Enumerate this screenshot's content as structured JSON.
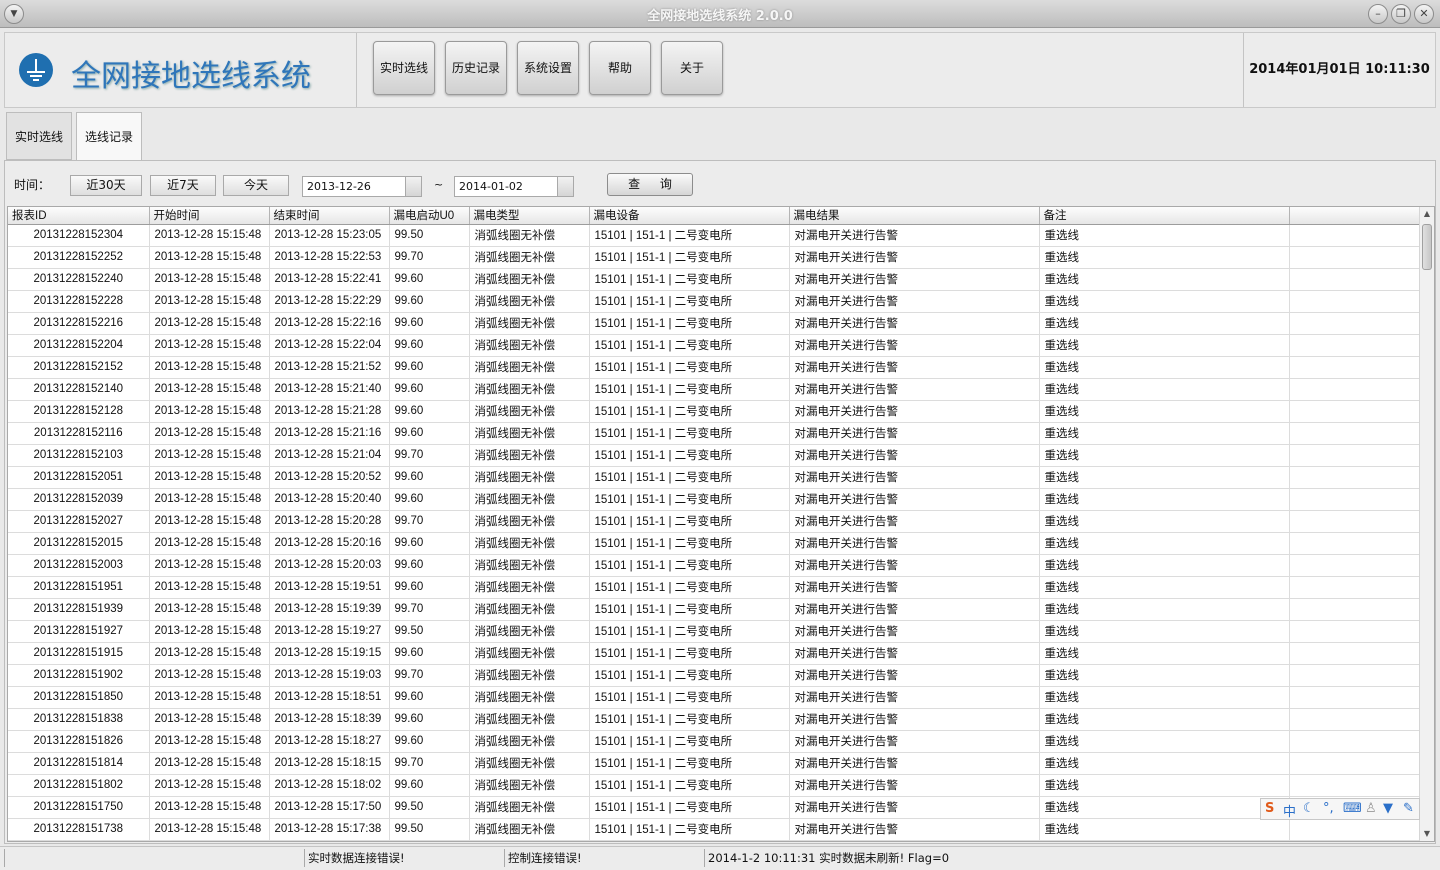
{
  "window": {
    "title": "全网接地选线系统 2.0.0",
    "menu_icon": "chevron-down-icon",
    "min_icon": "minimize-icon",
    "max_icon": "restore-icon",
    "close_icon": "close-icon"
  },
  "header": {
    "app_name": "全网接地选线系统",
    "logo_icon": "ground-symbol-icon",
    "nav_buttons": [
      "实时选线",
      "历史记录",
      "系统设置",
      "帮助",
      "关于"
    ],
    "datetime": "2014年01月01日 10:11:30"
  },
  "tabs": [
    "实时选线",
    "选线记录"
  ],
  "active_tab": "选线记录",
  "filter": {
    "label": "时间：",
    "quick_buttons": [
      "近30天",
      "近7天",
      "今天"
    ],
    "start_date": "2013-12-26",
    "separator": "~",
    "end_date": "2014-01-02",
    "query_label": "查 询"
  },
  "table": {
    "columns": [
      "报表ID",
      "开始时间",
      "结束时间",
      "漏电启动U0",
      "漏电类型",
      "漏电设备",
      "漏电结果",
      "备注"
    ],
    "rows": [
      [
        "20131228152304",
        "2013-12-28 15:15:48",
        "2013-12-28 15:23:05",
        "99.50",
        "消弧线圈无补偿",
        "15101 | 151-1 | 二号变电所",
        "对漏电开关进行告警",
        "重选线"
      ],
      [
        "20131228152252",
        "2013-12-28 15:15:48",
        "2013-12-28 15:22:53",
        "99.70",
        "消弧线圈无补偿",
        "15101 | 151-1 | 二号变电所",
        "对漏电开关进行告警",
        "重选线"
      ],
      [
        "20131228152240",
        "2013-12-28 15:15:48",
        "2013-12-28 15:22:41",
        "99.60",
        "消弧线圈无补偿",
        "15101 | 151-1 | 二号变电所",
        "对漏电开关进行告警",
        "重选线"
      ],
      [
        "20131228152228",
        "2013-12-28 15:15:48",
        "2013-12-28 15:22:29",
        "99.60",
        "消弧线圈无补偿",
        "15101 | 151-1 | 二号变电所",
        "对漏电开关进行告警",
        "重选线"
      ],
      [
        "20131228152216",
        "2013-12-28 15:15:48",
        "2013-12-28 15:22:16",
        "99.60",
        "消弧线圈无补偿",
        "15101 | 151-1 | 二号变电所",
        "对漏电开关进行告警",
        "重选线"
      ],
      [
        "20131228152204",
        "2013-12-28 15:15:48",
        "2013-12-28 15:22:04",
        "99.60",
        "消弧线圈无补偿",
        "15101 | 151-1 | 二号变电所",
        "对漏电开关进行告警",
        "重选线"
      ],
      [
        "20131228152152",
        "2013-12-28 15:15:48",
        "2013-12-28 15:21:52",
        "99.60",
        "消弧线圈无补偿",
        "15101 | 151-1 | 二号变电所",
        "对漏电开关进行告警",
        "重选线"
      ],
      [
        "20131228152140",
        "2013-12-28 15:15:48",
        "2013-12-28 15:21:40",
        "99.60",
        "消弧线圈无补偿",
        "15101 | 151-1 | 二号变电所",
        "对漏电开关进行告警",
        "重选线"
      ],
      [
        "20131228152128",
        "2013-12-28 15:15:48",
        "2013-12-28 15:21:28",
        "99.60",
        "消弧线圈无补偿",
        "15101 | 151-1 | 二号变电所",
        "对漏电开关进行告警",
        "重选线"
      ],
      [
        "20131228152116",
        "2013-12-28 15:15:48",
        "2013-12-28 15:21:16",
        "99.60",
        "消弧线圈无补偿",
        "15101 | 151-1 | 二号变电所",
        "对漏电开关进行告警",
        "重选线"
      ],
      [
        "20131228152103",
        "2013-12-28 15:15:48",
        "2013-12-28 15:21:04",
        "99.70",
        "消弧线圈无补偿",
        "15101 | 151-1 | 二号变电所",
        "对漏电开关进行告警",
        "重选线"
      ],
      [
        "20131228152051",
        "2013-12-28 15:15:48",
        "2013-12-28 15:20:52",
        "99.60",
        "消弧线圈无补偿",
        "15101 | 151-1 | 二号变电所",
        "对漏电开关进行告警",
        "重选线"
      ],
      [
        "20131228152039",
        "2013-12-28 15:15:48",
        "2013-12-28 15:20:40",
        "99.60",
        "消弧线圈无补偿",
        "15101 | 151-1 | 二号变电所",
        "对漏电开关进行告警",
        "重选线"
      ],
      [
        "20131228152027",
        "2013-12-28 15:15:48",
        "2013-12-28 15:20:28",
        "99.70",
        "消弧线圈无补偿",
        "15101 | 151-1 | 二号变电所",
        "对漏电开关进行告警",
        "重选线"
      ],
      [
        "20131228152015",
        "2013-12-28 15:15:48",
        "2013-12-28 15:20:16",
        "99.60",
        "消弧线圈无补偿",
        "15101 | 151-1 | 二号变电所",
        "对漏电开关进行告警",
        "重选线"
      ],
      [
        "20131228152003",
        "2013-12-28 15:15:48",
        "2013-12-28 15:20:03",
        "99.60",
        "消弧线圈无补偿",
        "15101 | 151-1 | 二号变电所",
        "对漏电开关进行告警",
        "重选线"
      ],
      [
        "20131228151951",
        "2013-12-28 15:15:48",
        "2013-12-28 15:19:51",
        "99.60",
        "消弧线圈无补偿",
        "15101 | 151-1 | 二号变电所",
        "对漏电开关进行告警",
        "重选线"
      ],
      [
        "20131228151939",
        "2013-12-28 15:15:48",
        "2013-12-28 15:19:39",
        "99.70",
        "消弧线圈无补偿",
        "15101 | 151-1 | 二号变电所",
        "对漏电开关进行告警",
        "重选线"
      ],
      [
        "20131228151927",
        "2013-12-28 15:15:48",
        "2013-12-28 15:19:27",
        "99.50",
        "消弧线圈无补偿",
        "15101 | 151-1 | 二号变电所",
        "对漏电开关进行告警",
        "重选线"
      ],
      [
        "20131228151915",
        "2013-12-28 15:15:48",
        "2013-12-28 15:19:15",
        "99.60",
        "消弧线圈无补偿",
        "15101 | 151-1 | 二号变电所",
        "对漏电开关进行告警",
        "重选线"
      ],
      [
        "20131228151902",
        "2013-12-28 15:15:48",
        "2013-12-28 15:19:03",
        "99.70",
        "消弧线圈无补偿",
        "15101 | 151-1 | 二号变电所",
        "对漏电开关进行告警",
        "重选线"
      ],
      [
        "20131228151850",
        "2013-12-28 15:15:48",
        "2013-12-28 15:18:51",
        "99.60",
        "消弧线圈无补偿",
        "15101 | 151-1 | 二号变电所",
        "对漏电开关进行告警",
        "重选线"
      ],
      [
        "20131228151838",
        "2013-12-28 15:15:48",
        "2013-12-28 15:18:39",
        "99.60",
        "消弧线圈无补偿",
        "15101 | 151-1 | 二号变电所",
        "对漏电开关进行告警",
        "重选线"
      ],
      [
        "20131228151826",
        "2013-12-28 15:15:48",
        "2013-12-28 15:18:27",
        "99.60",
        "消弧线圈无补偿",
        "15101 | 151-1 | 二号变电所",
        "对漏电开关进行告警",
        "重选线"
      ],
      [
        "20131228151814",
        "2013-12-28 15:15:48",
        "2013-12-28 15:18:15",
        "99.70",
        "消弧线圈无补偿",
        "15101 | 151-1 | 二号变电所",
        "对漏电开关进行告警",
        "重选线"
      ],
      [
        "20131228151802",
        "2013-12-28 15:15:48",
        "2013-12-28 15:18:02",
        "99.60",
        "消弧线圈无补偿",
        "15101 | 151-1 | 二号变电所",
        "对漏电开关进行告警",
        "重选线"
      ],
      [
        "20131228151750",
        "2013-12-28 15:15:48",
        "2013-12-28 15:17:50",
        "99.50",
        "消弧线圈无补偿",
        "15101 | 151-1 | 二号变电所",
        "对漏电开关进行告警",
        "重选线"
      ],
      [
        "20131228151738",
        "2013-12-28 15:15:48",
        "2013-12-28 15:17:38",
        "99.50",
        "消弧线圈无补偿",
        "15101 | 151-1 | 二号变电所",
        "对漏电开关进行告警",
        "重选线"
      ]
    ]
  },
  "ime_toolbar": {
    "mode_label": "中",
    "icons": [
      "sogou-logo-icon",
      "moon-icon",
      "punctuation-icon",
      "keyboard-icon",
      "user-icon",
      "shirt-icon",
      "wrench-icon"
    ]
  },
  "statusbar": {
    "segments": [
      "",
      "实时数据连接错误!",
      "控制连接错误!",
      "2014-1-2 10:11:31 实时数据未刷新! Flag=0"
    ]
  },
  "colors": {
    "brand": "#2f76ba",
    "logo_bg": "#1f6fb0"
  }
}
